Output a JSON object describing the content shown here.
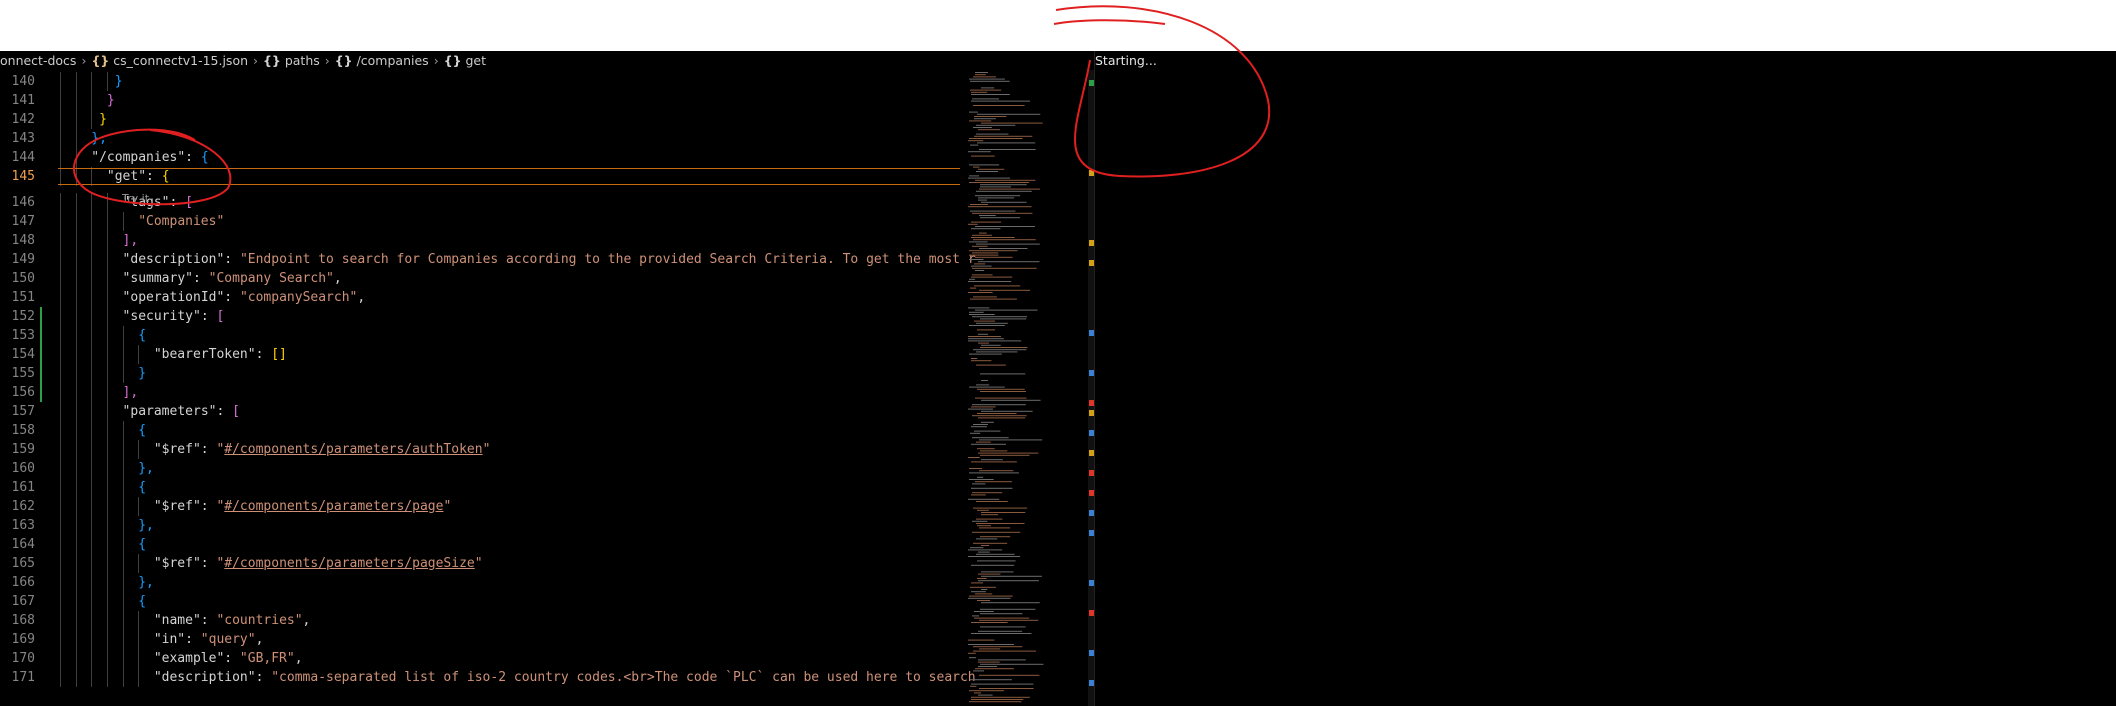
{
  "breadcrumb": {
    "root": "onnect-docs",
    "file": "cs_connectv1-15.json",
    "paths": "paths",
    "companies": "/companies",
    "get": "get"
  },
  "codelens": "Try it",
  "terminal": {
    "status": "Starting..."
  },
  "lines": [
    {
      "n": "140",
      "i": 7,
      "parts": [
        {
          "t": "}",
          "c": "b2"
        }
      ]
    },
    {
      "n": "141",
      "i": 6,
      "parts": [
        {
          "t": "}",
          "c": "b1"
        }
      ]
    },
    {
      "n": "142",
      "i": 5,
      "parts": [
        {
          "t": "}",
          "c": "b3"
        }
      ]
    },
    {
      "n": "143",
      "i": 4,
      "parts": [
        {
          "t": "},",
          "c": "b2"
        }
      ]
    },
    {
      "n": "144",
      "i": 4,
      "parts": [
        {
          "t": "\"/companies\": ",
          "c": "k"
        },
        {
          "t": "{",
          "c": "b2"
        }
      ]
    },
    {
      "n": "145",
      "i": 6,
      "active": true,
      "parts": [
        {
          "t": "\"get\": ",
          "c": "k"
        },
        {
          "t": "{",
          "c": "b3"
        }
      ]
    },
    {
      "n": "146",
      "i": 8,
      "parts": [
        {
          "t": "\"tags\": ",
          "c": "k"
        },
        {
          "t": "[",
          "c": "b1"
        }
      ]
    },
    {
      "n": "147",
      "i": 10,
      "parts": [
        {
          "t": "\"Companies\"",
          "c": "s"
        }
      ]
    },
    {
      "n": "148",
      "i": 8,
      "parts": [
        {
          "t": "],",
          "c": "b1"
        }
      ]
    },
    {
      "n": "149",
      "i": 8,
      "parts": [
        {
          "t": "\"description\": ",
          "c": "k"
        },
        {
          "t": "\"Endpoint to search for Companies according to the provided Search Criteria. To get the most r",
          "c": "s"
        }
      ]
    },
    {
      "n": "150",
      "i": 8,
      "parts": [
        {
          "t": "\"summary\": ",
          "c": "k"
        },
        {
          "t": "\"Company Search\"",
          "c": "s"
        },
        {
          "t": ",",
          "c": "k"
        }
      ]
    },
    {
      "n": "151",
      "i": 8,
      "parts": [
        {
          "t": "\"operationId\": ",
          "c": "k"
        },
        {
          "t": "\"companySearch\"",
          "c": "s"
        },
        {
          "t": ",",
          "c": "k"
        }
      ]
    },
    {
      "n": "152",
      "i": 8,
      "parts": [
        {
          "t": "\"security\": ",
          "c": "k"
        },
        {
          "t": "[",
          "c": "b1"
        }
      ]
    },
    {
      "n": "153",
      "i": 10,
      "parts": [
        {
          "t": "{",
          "c": "b2"
        }
      ]
    },
    {
      "n": "154",
      "i": 12,
      "parts": [
        {
          "t": "\"bearerToken\": ",
          "c": "k"
        },
        {
          "t": "[]",
          "c": "b3"
        }
      ]
    },
    {
      "n": "155",
      "i": 10,
      "parts": [
        {
          "t": "}",
          "c": "b2"
        }
      ]
    },
    {
      "n": "156",
      "i": 8,
      "parts": [
        {
          "t": "],",
          "c": "b1"
        }
      ]
    },
    {
      "n": "157",
      "i": 8,
      "parts": [
        {
          "t": "\"parameters\": ",
          "c": "k"
        },
        {
          "t": "[",
          "c": "b1"
        }
      ]
    },
    {
      "n": "158",
      "i": 10,
      "parts": [
        {
          "t": "{",
          "c": "b2"
        }
      ]
    },
    {
      "n": "159",
      "i": 12,
      "parts": [
        {
          "t": "\"$ref\": ",
          "c": "k"
        },
        {
          "t": "\"",
          "c": "s"
        },
        {
          "t": "#/components/parameters/authToken",
          "c": "u"
        },
        {
          "t": "\"",
          "c": "s"
        }
      ]
    },
    {
      "n": "160",
      "i": 10,
      "parts": [
        {
          "t": "},",
          "c": "b2"
        }
      ]
    },
    {
      "n": "161",
      "i": 10,
      "parts": [
        {
          "t": "{",
          "c": "b2"
        }
      ]
    },
    {
      "n": "162",
      "i": 12,
      "parts": [
        {
          "t": "\"$ref\": ",
          "c": "k"
        },
        {
          "t": "\"",
          "c": "s"
        },
        {
          "t": "#/components/parameters/page",
          "c": "u"
        },
        {
          "t": "\"",
          "c": "s"
        }
      ]
    },
    {
      "n": "163",
      "i": 10,
      "parts": [
        {
          "t": "},",
          "c": "b2"
        }
      ]
    },
    {
      "n": "164",
      "i": 10,
      "parts": [
        {
          "t": "{",
          "c": "b2"
        }
      ]
    },
    {
      "n": "165",
      "i": 12,
      "parts": [
        {
          "t": "\"$ref\": ",
          "c": "k"
        },
        {
          "t": "\"",
          "c": "s"
        },
        {
          "t": "#/components/parameters/pageSize",
          "c": "u"
        },
        {
          "t": "\"",
          "c": "s"
        }
      ]
    },
    {
      "n": "166",
      "i": 10,
      "parts": [
        {
          "t": "},",
          "c": "b2"
        }
      ]
    },
    {
      "n": "167",
      "i": 10,
      "parts": [
        {
          "t": "{",
          "c": "b2"
        }
      ]
    },
    {
      "n": "168",
      "i": 12,
      "parts": [
        {
          "t": "\"name\": ",
          "c": "k"
        },
        {
          "t": "\"countries\"",
          "c": "s"
        },
        {
          "t": ",",
          "c": "k"
        }
      ]
    },
    {
      "n": "169",
      "i": 12,
      "parts": [
        {
          "t": "\"in\": ",
          "c": "k"
        },
        {
          "t": "\"query\"",
          "c": "s"
        },
        {
          "t": ",",
          "c": "k"
        }
      ]
    },
    {
      "n": "170",
      "i": 12,
      "parts": [
        {
          "t": "\"example\": ",
          "c": "k"
        },
        {
          "t": "\"GB,FR\"",
          "c": "s"
        },
        {
          "t": ",",
          "c": "k"
        }
      ]
    },
    {
      "n": "171",
      "i": 12,
      "parts": [
        {
          "t": "\"description\": ",
          "c": "k"
        },
        {
          "t": "\"comma-separated list of iso-2 country codes.<br>The code `PLC` can be used here to search",
          "c": "s"
        }
      ]
    }
  ]
}
